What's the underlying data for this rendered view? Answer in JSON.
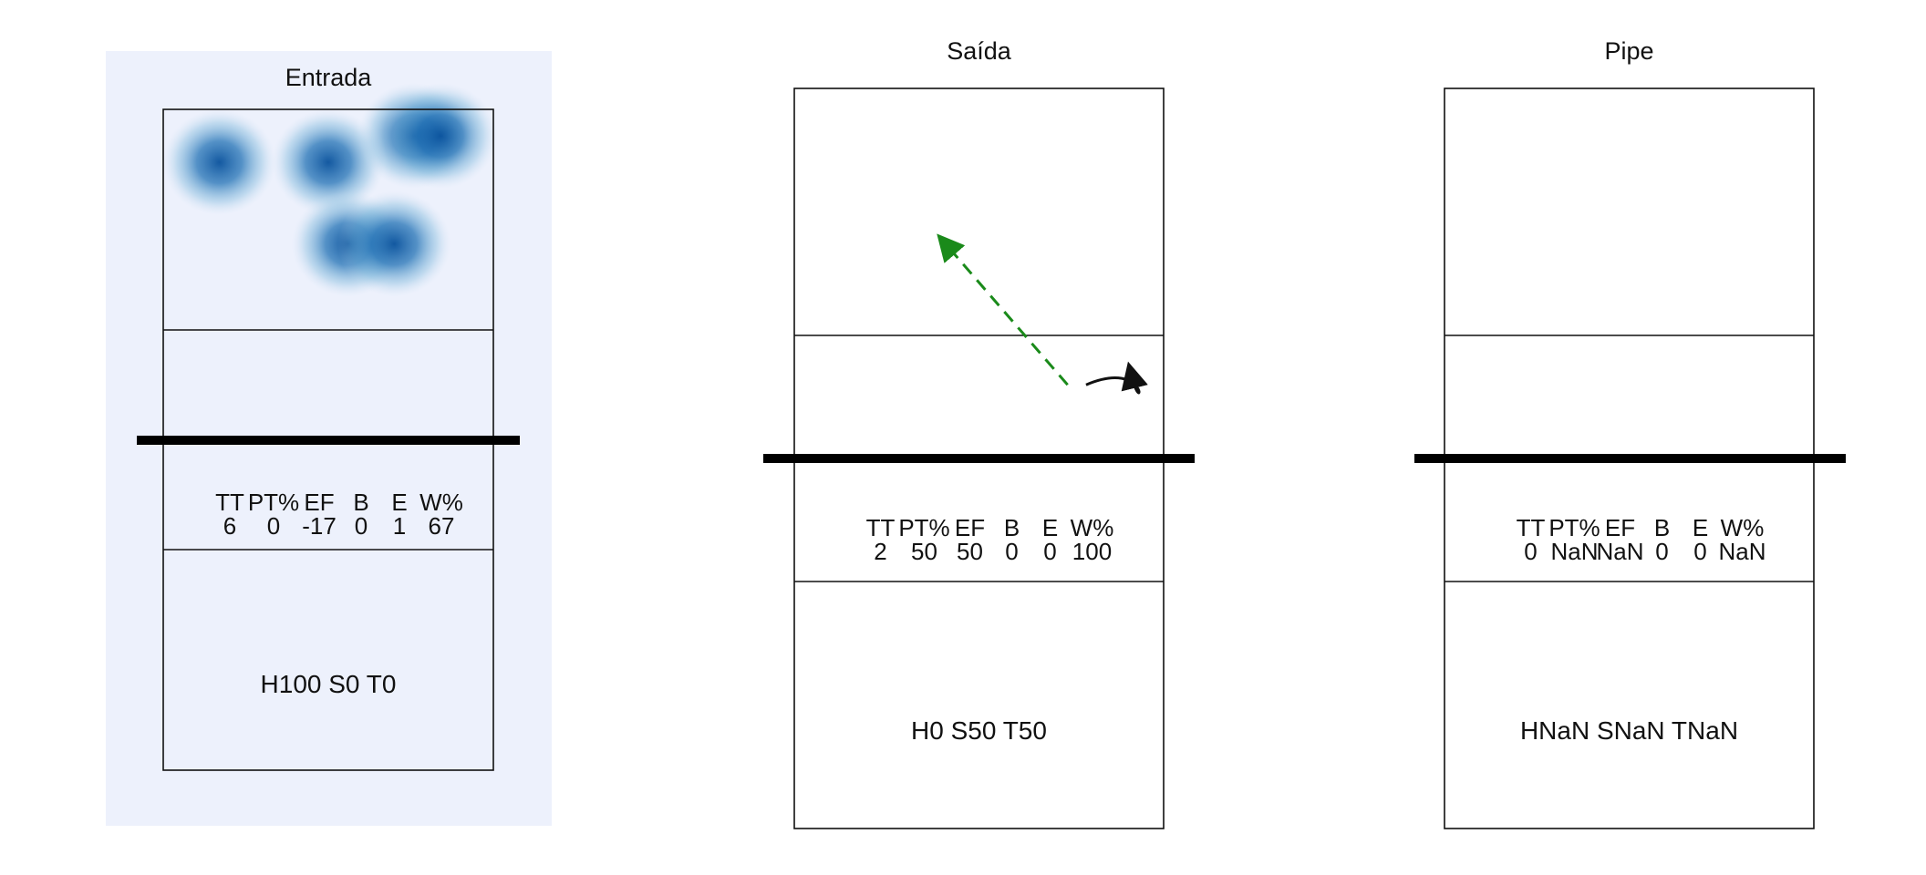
{
  "chart_data": [
    {
      "type": "heatmap",
      "title": "Entrada",
      "stats_header": [
        "TT",
        "PT%",
        "EF",
        "B",
        "E",
        "W%"
      ],
      "stats_values": [
        "6",
        "0",
        "-17",
        "0",
        "1",
        "67"
      ],
      "summary": "H100 S0 T0",
      "heatmap": true,
      "hotspots": [
        {
          "x": 0.17,
          "y": 0.24
        },
        {
          "x": 0.5,
          "y": 0.24
        },
        {
          "x": 0.76,
          "y": 0.12
        },
        {
          "x": 0.84,
          "y": 0.12
        },
        {
          "x": 0.56,
          "y": 0.61
        },
        {
          "x": 0.7,
          "y": 0.61
        }
      ],
      "arrows": []
    },
    {
      "type": "scatter",
      "title": "Saída",
      "stats_header": [
        "TT",
        "PT%",
        "EF",
        "B",
        "E",
        "W%"
      ],
      "stats_values": [
        "2",
        "50",
        "50",
        "0",
        "0",
        "100"
      ],
      "summary": "H0 S50 T50",
      "heatmap": false,
      "hotspots": [],
      "arrows": [
        {
          "from": [
            0.74,
            1.2
          ],
          "to": [
            0.41,
            0.63
          ],
          "style": "dashed",
          "color": "#1a8a1a"
        },
        {
          "from": [
            0.79,
            1.2
          ],
          "to": [
            0.92,
            1.13
          ],
          "style": "curve",
          "color": "#111111"
        }
      ]
    },
    {
      "type": "scatter",
      "title": "Pipe",
      "stats_header": [
        "TT",
        "PT%",
        "EF",
        "B",
        "E",
        "W%"
      ],
      "stats_values": [
        "0",
        "NaN",
        "NaN",
        "0",
        "0",
        "NaN"
      ],
      "summary": "HNaN SNaN TNaN",
      "heatmap": false,
      "hotspots": [],
      "arrows": []
    }
  ]
}
